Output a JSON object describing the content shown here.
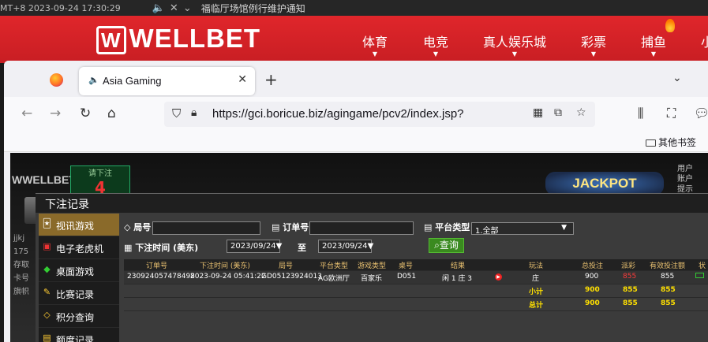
{
  "ticker": {
    "time": "MT+8 2023-09-24 17:30:29",
    "notice": "福临厅场馆例行维护通知"
  },
  "site": {
    "logo": "WELLBET",
    "nav": [
      "体育",
      "电竞",
      "真人娱乐城",
      "彩票",
      "捕鱼",
      "小"
    ]
  },
  "browser": {
    "tab_title": "Asia Gaming",
    "url": "https://gci.boricue.biz/agingame/pcv2/index.jsp?",
    "bookmark_folder": "其他书签"
  },
  "game_bg": {
    "logo": "WELLBET",
    "bet_label": "请下注",
    "bet_num": "4",
    "jackpot": "JACKPOT",
    "right_info": [
      "用户",
      "账户",
      "提示"
    ],
    "user": "jjkj",
    "user_num": "175",
    "left_items": [
      "存取",
      "卡号",
      "旗帜"
    ]
  },
  "dialog": {
    "title": "下注记录",
    "menu": [
      {
        "icon": "cards-icon",
        "label": "视讯游戏",
        "active": true
      },
      {
        "icon": "slot-icon",
        "label": "电子老虎机",
        "active": false
      },
      {
        "icon": "chips-icon",
        "label": "桌面游戏",
        "active": false
      },
      {
        "icon": "record-icon",
        "label": "比赛记录",
        "active": false
      },
      {
        "icon": "diamond-icon",
        "label": "积分查询",
        "active": false
      },
      {
        "icon": "note-icon",
        "label": "额度记录",
        "active": false
      }
    ],
    "filters": {
      "round_label": "局号",
      "order_label": "订单号",
      "platform_label": "平台类型",
      "platform_value": "1.全部",
      "time_label": "下注时间 (美东)",
      "date_from": "2023/09/24",
      "to_label": "至",
      "date_to": "2023/09/24",
      "query": "查询"
    },
    "table": {
      "headers": [
        "订单号",
        "下注时间 (美东)",
        "局号",
        "平台类型",
        "游戏类型",
        "桌号",
        "结果",
        "玩法",
        "总投注",
        "派彩",
        "有效投注额",
        "状"
      ],
      "row": {
        "order": "230924057478498",
        "time": "2023-09-24 05:41:22",
        "round": "GD05123924013",
        "platform": "AG欧洲厅",
        "game": "百家乐",
        "table": "D051",
        "result": "闲 1 庄 3",
        "play": "庄",
        "bet": "900",
        "payout": "855",
        "valid": "855"
      },
      "subtotal": {
        "label": "小计",
        "bet": "900",
        "payout": "855",
        "valid": "855"
      },
      "total": {
        "label": "总计",
        "bet": "900",
        "payout": "855",
        "valid": "855"
      }
    }
  }
}
